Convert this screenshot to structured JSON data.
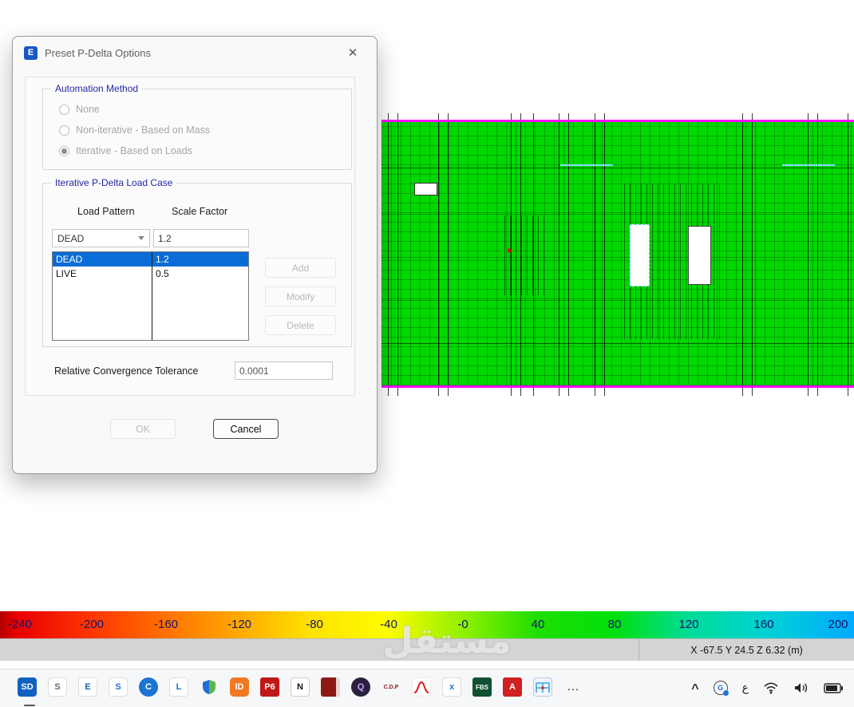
{
  "window": {
    "title": "Preset P-Delta Options",
    "app_icon": "E",
    "close": "✕"
  },
  "automation": {
    "group_label": "Automation Method",
    "selected_index": 2,
    "options": [
      {
        "label": "None"
      },
      {
        "label": "Non-iterative - Based on Mass"
      },
      {
        "label": "Iterative - Based on Loads"
      }
    ]
  },
  "load_case": {
    "group_label": "Iterative P-Delta Load Case",
    "headers": {
      "pattern": "Load Pattern",
      "factor": "Scale Factor"
    },
    "editor": {
      "pattern_value": "DEAD",
      "factor_value": "1.2"
    },
    "rows": [
      {
        "pattern": "DEAD",
        "factor": "1.2",
        "selected": true
      },
      {
        "pattern": "LIVE",
        "factor": "0.5",
        "selected": false
      }
    ],
    "buttons": {
      "add": "Add",
      "modify": "Modify",
      "delete": "Delete"
    }
  },
  "tolerance": {
    "label": "Relative Convergence Tolerance",
    "value": "0.0001"
  },
  "actions": {
    "ok": "OK",
    "cancel": "Cancel"
  },
  "legend": {
    "labels": [
      "-240",
      "-200",
      "-160",
      "-120",
      "-80",
      "-40",
      "-0",
      "40",
      "80",
      "120",
      "160",
      "200"
    ],
    "colors": [
      "#e80000",
      "#ff3800",
      "#ff7100",
      "#ffaa00",
      "#ffe300",
      "#fdfd00",
      "#8cf000",
      "#1ede00",
      "#00e00e",
      "#00dc96",
      "#00d2d2",
      "#00aaff"
    ]
  },
  "status": {
    "coords": "X -67.5 Y 24.5 Z 6.32 (m)"
  },
  "taskbar": {
    "icons": {
      "sd": "SD",
      "sap": "S",
      "etabs": "E",
      "safe": "S",
      "csicol": "C",
      "lpile": "L",
      "detail": "ID",
      "p6": "P6",
      "n": "N",
      "q": "Q",
      "cdp": "C.D.P",
      "x": "x",
      "fbs": "FBS",
      "alert": "A",
      "more": "…"
    },
    "tray": {
      "chevron": "^",
      "browser": "G",
      "lang": "ع"
    }
  },
  "watermark": {
    "text": "مستقل"
  },
  "colors": {
    "mesh_green": "#00d800",
    "boundary_magenta": "#ff00ff",
    "selection_blue": "#0a6cd6",
    "group_label_blue": "#2626a6"
  }
}
